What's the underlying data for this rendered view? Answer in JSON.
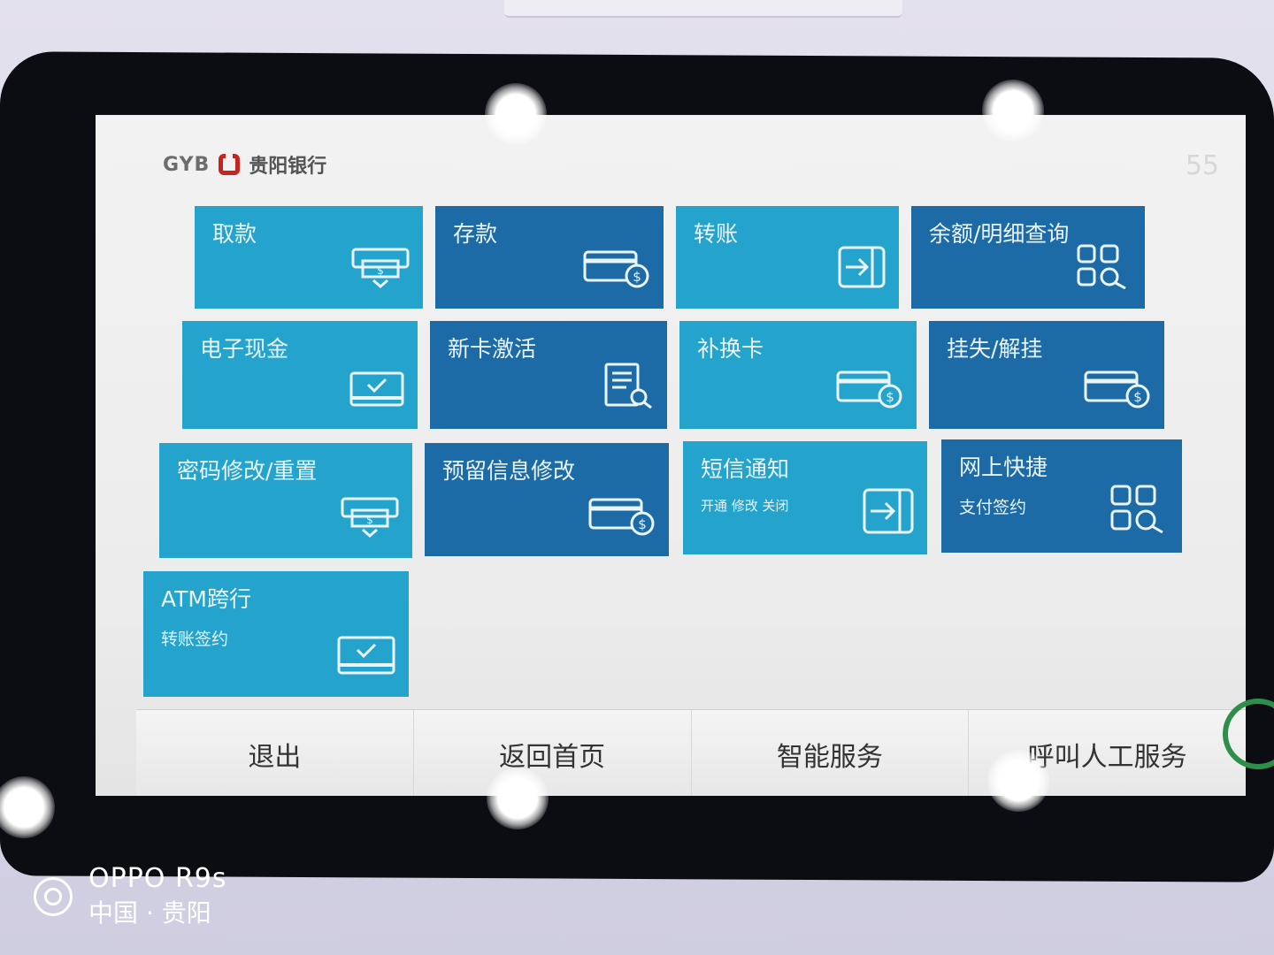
{
  "header": {
    "logo_text": "GYB",
    "bank_name": "贵阳银行",
    "timer": "55"
  },
  "tiles": [
    {
      "label": "取款",
      "sub": "",
      "icon": "cash-dispense-icon"
    },
    {
      "label": "存款",
      "sub": "",
      "icon": "card-dollar-icon"
    },
    {
      "label": "转账",
      "sub": "",
      "icon": "transfer-arrow-icon"
    },
    {
      "label": "余额/明细查询",
      "sub": "",
      "icon": "grid-search-icon"
    },
    {
      "label": "电子现金",
      "sub": "",
      "icon": "card-check-icon"
    },
    {
      "label": "新卡激活",
      "sub": "",
      "icon": "document-search-icon"
    },
    {
      "label": "补换卡",
      "sub": "",
      "icon": "card-dollar-icon"
    },
    {
      "label": "挂失/解挂",
      "sub": "",
      "icon": "card-dollar-icon"
    },
    {
      "label": "密码修改/重置",
      "sub": "",
      "icon": "cash-dispense-icon"
    },
    {
      "label": "预留信息修改",
      "sub": "",
      "icon": "card-dollar-icon"
    },
    {
      "label": "短信通知",
      "sub": "开通 修改 关闭",
      "icon": "transfer-arrow-icon"
    },
    {
      "label": "网上快捷",
      "sub": "支付签约",
      "icon": "grid-search-icon"
    },
    {
      "label": "ATM跨行",
      "sub": "转账签约",
      "icon": "card-check-icon"
    }
  ],
  "bottom_bar": {
    "exit": "退出",
    "home": "返回首页",
    "smart_service": "智能服务",
    "call_staff": "呼叫人工服务"
  },
  "watermark": {
    "model": "OPPO R9s",
    "place": "中国 · 贵阳"
  },
  "colors": {
    "tile_light": "#24a3cc",
    "tile_dark": "#1c6aa6",
    "logo_red": "#c6241e"
  }
}
